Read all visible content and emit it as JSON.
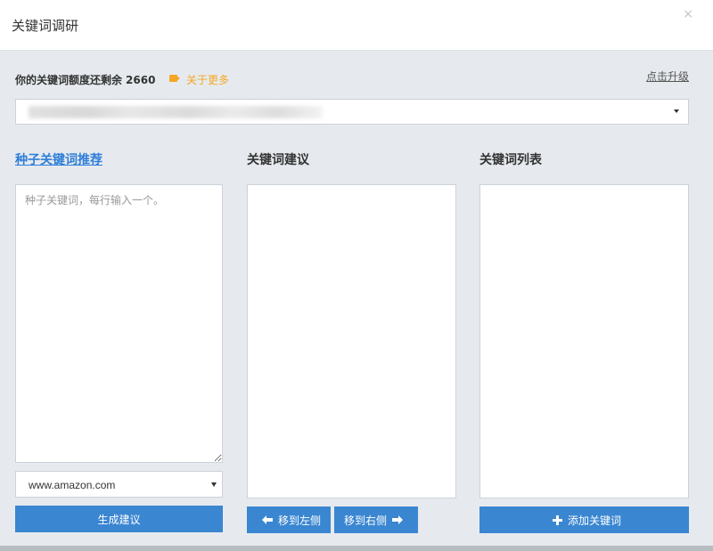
{
  "dialog": {
    "title": "关键词调研",
    "close_symbol": "×"
  },
  "quota": {
    "label": "你的关键词额度还剩余",
    "remaining": "2660",
    "learn_more": "关于更多",
    "upgrade": "点击升级"
  },
  "columns": {
    "seed": {
      "title": "种子关键词推荐",
      "placeholder": "种子关键词，每行输入一个。",
      "site": "www.amazon.com",
      "generate_button": "生成建议"
    },
    "suggestions": {
      "title": "关键词建议",
      "move_left_button": "移到左侧",
      "move_right_button": "移到右侧"
    },
    "list": {
      "title": "关键词列表",
      "add_button": "添加关键词"
    }
  },
  "colors": {
    "accent": "#3a86d1",
    "link": "#2f7ed8",
    "highlight": "#f5a623"
  }
}
